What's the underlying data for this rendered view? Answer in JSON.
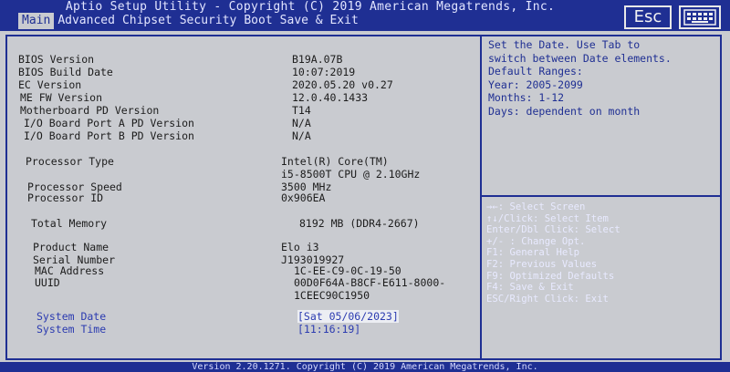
{
  "header": {
    "title": "Aptio Setup Utility - Copyright (C) 2019 American Megatrends, Inc.",
    "tabs": [
      "Main",
      "Advanced",
      "Chipset",
      "Security",
      "Boot",
      "Save & Exit"
    ],
    "active_tab": "Main",
    "esc_label": "Esc",
    "keyboard_icon": "keyboard-icon"
  },
  "main": {
    "bios_version_label": "BIOS Version",
    "bios_version": "B19A.07B",
    "bios_build_date_label": "BIOS Build Date",
    "bios_build_date": "10:07:2019",
    "ec_version_label": "EC Version",
    "ec_version": "2020.05.20 v0.27",
    "me_fw_label": "ME FW Version",
    "me_fw": "12.0.40.1433",
    "mb_pd_label": "Motherboard PD Version",
    "mb_pd": "T14",
    "io_a_label": "I/O Board Port A PD Version",
    "io_a": "N/A",
    "io_b_label": "I/O Board Port B PD Version",
    "io_b": "N/A",
    "cpu_type_label": "Processor Type",
    "cpu_type_1": "Intel(R) Core(TM)",
    "cpu_type_2": "i5-8500T CPU @ 2.10GHz",
    "cpu_speed_label": "Processor Speed",
    "cpu_speed": "3500 MHz",
    "cpu_id_label": "Processor ID",
    "cpu_id": "0x906EA",
    "mem_label": "Total Memory",
    "mem": "8192 MB (DDR4-2667)",
    "product_label": "Product Name",
    "product": "Elo i3",
    "serial_label": "Serial Number",
    "serial": "J193019927",
    "mac_label": "MAC Address",
    "mac": "1C-EE-C9-0C-19-50",
    "uuid_label": "UUID",
    "uuid_1": "00D0F64A-B8CF-E611-8000-",
    "uuid_2": "1CEEC90C1950",
    "date_label": "System Date",
    "date": "[Sat 05/06/2023]",
    "time_label": "System Time",
    "time": "[11:16:19]"
  },
  "help": {
    "lines": [
      "Set the Date. Use Tab to",
      "switch between Date elements.",
      "Default Ranges:",
      "Year: 2005-2099",
      "Months: 1-12",
      "Days: dependent on month"
    ]
  },
  "keys": {
    "lines": [
      "→←: Select Screen",
      "↑↓/Click: Select Item",
      "Enter/Dbl Click: Select",
      "+/- : Change Opt.",
      "F1: General Help",
      "F2: Previous Values",
      "F9: Optimized Defaults",
      "F4: Save & Exit",
      "ESC/Right Click: Exit"
    ]
  },
  "footer": {
    "text": "Version 2.20.1271. Copyright (C) 2019 American Megatrends, Inc."
  },
  "colors": {
    "accent": "#1f2f93",
    "panel_bg": "#c9cbd0",
    "highlight_text": "#2b3bb0"
  }
}
